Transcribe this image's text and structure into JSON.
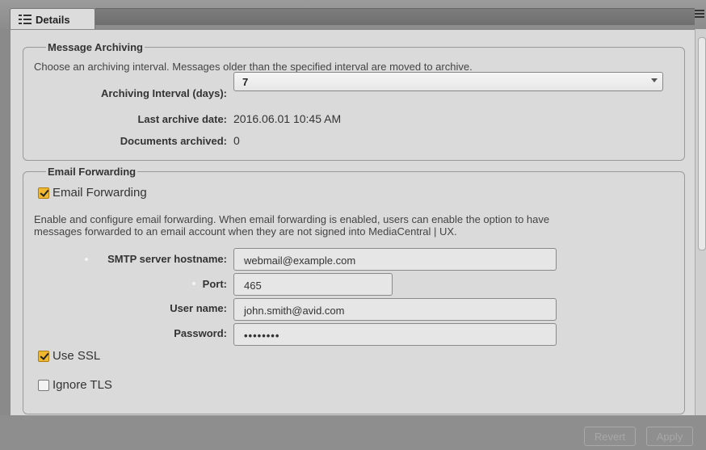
{
  "tab": {
    "label": "Details",
    "icon": "details-list-icon"
  },
  "archiving": {
    "legend": "Message Archiving",
    "description": "Choose an archiving interval. Messages older than the specified interval are moved to archive.",
    "interval_label": "Archiving Interval (days):",
    "interval_value": "7",
    "last_date_label": "Last archive date:",
    "last_date_value": "2016.06.01 10:45 AM",
    "docs_label": "Documents archived:",
    "docs_value": "0"
  },
  "forwarding": {
    "legend": "Email Forwarding",
    "checkbox_label": "Email Forwarding",
    "checkbox_checked": true,
    "description_line1": "Enable and configure email forwarding. When email forwarding is enabled, users can enable the option to have",
    "description_line2": "messages forwarded to an email account when they are not signed into MediaCentral | UX.",
    "smtp_label": "SMTP server hostname:",
    "smtp_value": "webmail@example.com",
    "port_label": "Port:",
    "port_value": "465",
    "user_label": "User name:",
    "user_value": "john.smith@avid.com",
    "password_label": "Password:",
    "password_value": "••••••••",
    "ssl_label": "Use SSL",
    "ssl_checked": true,
    "tls_label": "Ignore TLS",
    "tls_checked": false
  },
  "footer": {
    "revert_label": "Revert",
    "apply_label": "Apply"
  },
  "colors": {
    "accent": "#f0b830",
    "panel": "#dadada",
    "chrome": "#8a8a8a"
  }
}
